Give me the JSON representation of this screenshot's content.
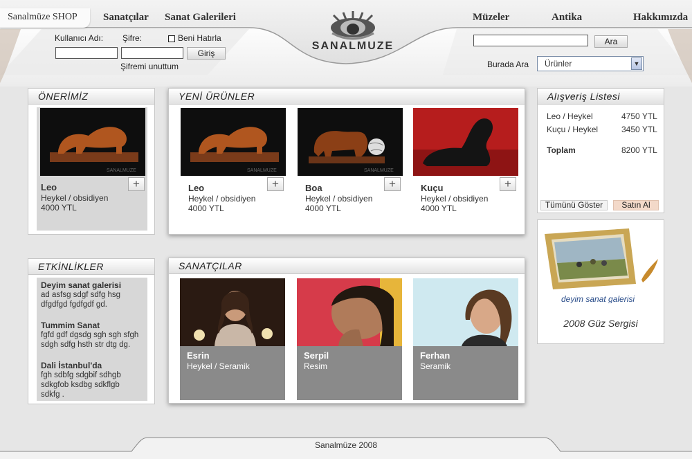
{
  "header": {
    "nav": {
      "shop": "Sanalmüze SHOP",
      "artists": "Sanatçılar",
      "galleries": "Sanat Galerileri",
      "museums": "Müzeler",
      "antiques": "Antika",
      "about": "Hakkımızda"
    },
    "logo_text": "SANALMUZE",
    "login": {
      "username_label": "Kullanıcı Adı:",
      "password_label": "Şifre:",
      "remember_label": "Beni Hatırla",
      "login_button": "Giriş",
      "forgot_link": "Şifremi unuttum",
      "username_value": "",
      "password_value": ""
    },
    "search": {
      "query_value": "",
      "search_button": "Ara",
      "scope_label": "Burada Ara",
      "scope_selected": "Ürünler"
    }
  },
  "recommended": {
    "title": "ÖNERİMİZ",
    "item": {
      "name": "Leo",
      "desc": "Heykel / obsidiyen",
      "price": "4000 YTL",
      "watermark": "SANALMUZE"
    }
  },
  "new_products": {
    "title": "YENİ ÜRÜNLER",
    "items": [
      {
        "name": "Leo",
        "desc": "Heykel / obsidiyen",
        "price": "4000 YTL",
        "watermark": "SANALMUZE"
      },
      {
        "name": "Boa",
        "desc": "Heykel / obsidiyen",
        "price": "4000 YTL",
        "watermark": "SANALMUZE"
      },
      {
        "name": "Kuçu",
        "desc": "Heykel / obsidiyen",
        "price": "4000 YTL",
        "watermark": ""
      }
    ]
  },
  "cart": {
    "title": "Alışveriş Listesi",
    "items": [
      {
        "name": "Leo / Heykel",
        "price": "4750 YTL"
      },
      {
        "name": "Kuçu / Heykel",
        "price": "3450 YTL"
      }
    ],
    "total_label": "Toplam",
    "total_value": "8200 YTL",
    "show_all_button": "Tümünü Göster",
    "buy_button": "Satın Al"
  },
  "promo": {
    "brand_text": "deyim sanat galerisi",
    "caption": "2008 Güz Sergisi"
  },
  "events": {
    "title": "ETKİNLİKLER",
    "items": [
      {
        "title": "Deyim sanat galerisi",
        "lines": [
          "ad asfsg sdgf sdfg hsg",
          "dfgdfgd fgdfgdf gd."
        ]
      },
      {
        "title": "Tummim Sanat",
        "lines": [
          "fgfd gdf dgsdg sgh sgh sfgh",
          "sdgh sdfg hsth str dtg dg."
        ]
      },
      {
        "title": "Dali İstanbul'da",
        "lines": [
          "fgh sdbfg sdgbif sdhgb",
          "sdkgfob ksdbg sdkflgb",
          "sdkfg ."
        ]
      }
    ]
  },
  "artists": {
    "title": "SANATÇILAR",
    "items": [
      {
        "name": "Esrin",
        "field": "Heykel / Seramik"
      },
      {
        "name": "Serpil",
        "field": "Resim"
      },
      {
        "name": "Ferhan",
        "field": "Seramik"
      }
    ]
  },
  "footer": {
    "text": "Sanalmüze 2008"
  },
  "colors": {
    "background": "#e6e6e6",
    "panel": "#ffffff",
    "card_gray": "#d7d7d7",
    "artist_card": "#8a8a8a",
    "buy_button": "#f3d9c9"
  },
  "icons": [
    "eye-logo-icon",
    "plus-icon",
    "chevron-down-icon"
  ]
}
